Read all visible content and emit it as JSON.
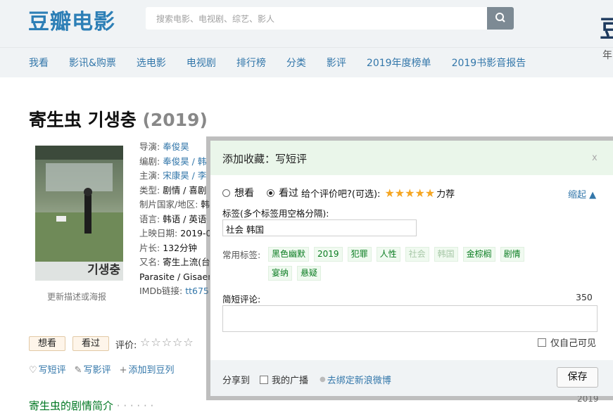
{
  "header": {
    "logo": "豆瓣电影",
    "search_placeholder": "搜索电影、电视剧、综艺、影人",
    "search_icon": "search-icon",
    "brand_right": "豆",
    "brand_right_year": "年"
  },
  "nav": [
    "我看",
    "影讯&购票",
    "选电影",
    "电视剧",
    "排行榜",
    "分类",
    "影评",
    "2019年度榜单",
    "2019书影音报告"
  ],
  "movie": {
    "title": "寄生虫 기생충",
    "year": "(2019)",
    "poster_caption": "기생충",
    "update_link": "更新描述或海报",
    "info": [
      {
        "label": "导演: ",
        "value": "奉俊昊",
        "link": true
      },
      {
        "label": "编剧: ",
        "value": "奉俊昊 / 韩",
        "link": true
      },
      {
        "label": "主演: ",
        "value": "宋康昊 / 李",
        "link": true
      },
      {
        "label": "类型: ",
        "value": "剧情 / 喜剧",
        "link": false
      },
      {
        "label": "制片国家/地区: ",
        "value": "韩",
        "link": false
      },
      {
        "label": "语言: ",
        "value": "韩语 / 英语",
        "link": false
      },
      {
        "label": "上映日期: ",
        "value": "2019-0",
        "link": false
      },
      {
        "label": "片长: ",
        "value": "132分钟",
        "link": false
      },
      {
        "label": "又名: ",
        "value": "寄生上流(台",
        "link": false
      },
      {
        "label": "",
        "value": "Parasite / Gisaen",
        "link": false
      },
      {
        "label": "IMDb链接: ",
        "value": "tt675",
        "link": true
      }
    ]
  },
  "rating_row": {
    "want": "想看",
    "seen": "看过",
    "label": "评价:",
    "stars": "☆☆☆☆☆"
  },
  "actions": [
    {
      "icon": "comment-icon",
      "glyph": "♡",
      "label": "写短评"
    },
    {
      "icon": "pencil-icon",
      "glyph": "✎",
      "label": "写影评"
    },
    {
      "icon": "plus-icon",
      "glyph": "+",
      "label": "添加到豆列"
    }
  ],
  "synopsis": {
    "title": "寄生虫的剧情简介",
    "dots": "· · · · · ·"
  },
  "year_tag": "2019",
  "modal": {
    "title": "添加收藏：写短评",
    "close": "x",
    "status_want": "想看",
    "status_seen": "看过",
    "selected": "看过",
    "rate_prompt": "给个评价吧?(可选):",
    "rating": 5,
    "rating_stars": "★★★★★",
    "rating_word": "力荐",
    "collapse": "缩起 ▲",
    "tag_label": "标签(多个标签用空格分隔):",
    "tag_value": "社会 韩国",
    "common_label": "常用标签:",
    "common_tags": [
      {
        "text": "黑色幽默",
        "dim": false
      },
      {
        "text": "2019",
        "dim": false
      },
      {
        "text": "犯罪",
        "dim": false
      },
      {
        "text": "人性",
        "dim": false
      },
      {
        "text": "社会",
        "dim": true
      },
      {
        "text": "韩国",
        "dim": true
      },
      {
        "text": "金棕榈",
        "dim": false
      },
      {
        "text": "剧情",
        "dim": false
      },
      {
        "text": "宴纳",
        "dim": false
      },
      {
        "text": "悬疑",
        "dim": false
      }
    ],
    "comment_label": "简短评论:",
    "char_count": "350",
    "comment_value": "",
    "private_label": "仅自己可见",
    "share_label": "分享到",
    "share_broadcast": "我的广播",
    "share_weibo": "去绑定新浪微博",
    "save": "保存"
  }
}
